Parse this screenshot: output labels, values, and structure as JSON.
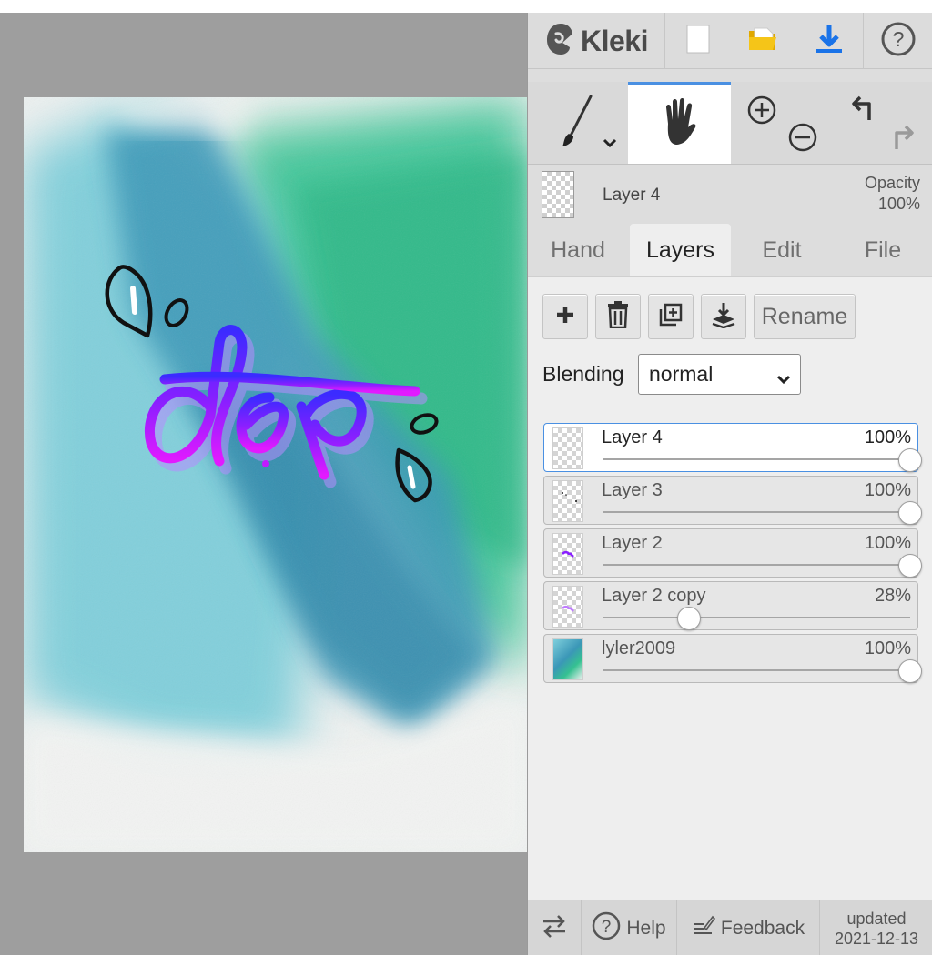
{
  "app": {
    "name": "Kleki"
  },
  "icons": {
    "logo": "kleki-logo-icon",
    "new": "new-image-icon",
    "open": "open-folder-icon",
    "save": "download-icon",
    "help": "help-circle-icon",
    "brush": "brush-icon",
    "brush_dropdown": "chevron-down-icon",
    "hand": "hand-icon",
    "zoom_in": "zoom-in-icon",
    "zoom_out": "zoom-out-icon",
    "undo": "undo-icon",
    "redo": "redo-icon",
    "add_layer": "plus-icon",
    "delete_layer": "trash-icon",
    "duplicate_layer": "duplicate-icon",
    "merge_layer": "merge-down-icon",
    "swap": "swap-arrows-icon",
    "feedback": "feedback-icon"
  },
  "colors": {
    "accent": "#4a90e2",
    "download": "#1a73e8",
    "folder": "#f2b705",
    "lettering_top": "#3b2bff",
    "lettering_bottom": "#e21aff"
  },
  "layer_info": {
    "name": "Layer 4",
    "opacity_label": "Opacity",
    "opacity_value": "100%"
  },
  "tabs": [
    {
      "label": "Hand",
      "active": false
    },
    {
      "label": "Layers",
      "active": true
    },
    {
      "label": "Edit",
      "active": false
    },
    {
      "label": "File",
      "active": false
    }
  ],
  "layers_panel": {
    "rename_label": "Rename",
    "blending_label": "Blending",
    "blending_value": "normal"
  },
  "layers": [
    {
      "name": "Layer 4",
      "opacity": "100%",
      "opacity_value": 1.0,
      "active": true
    },
    {
      "name": "Layer 3",
      "opacity": "100%",
      "opacity_value": 1.0,
      "active": false
    },
    {
      "name": "Layer 2",
      "opacity": "100%",
      "opacity_value": 1.0,
      "active": false
    },
    {
      "name": "Layer 2 copy",
      "opacity": "28%",
      "opacity_value": 0.28,
      "active": false
    },
    {
      "name": "lyler2009",
      "opacity": "100%",
      "opacity_value": 1.0,
      "active": false
    }
  ],
  "footer": {
    "help_label": "Help",
    "feedback_label": "Feedback",
    "updated_label": "updated",
    "updated_date": "2021-12-13"
  }
}
